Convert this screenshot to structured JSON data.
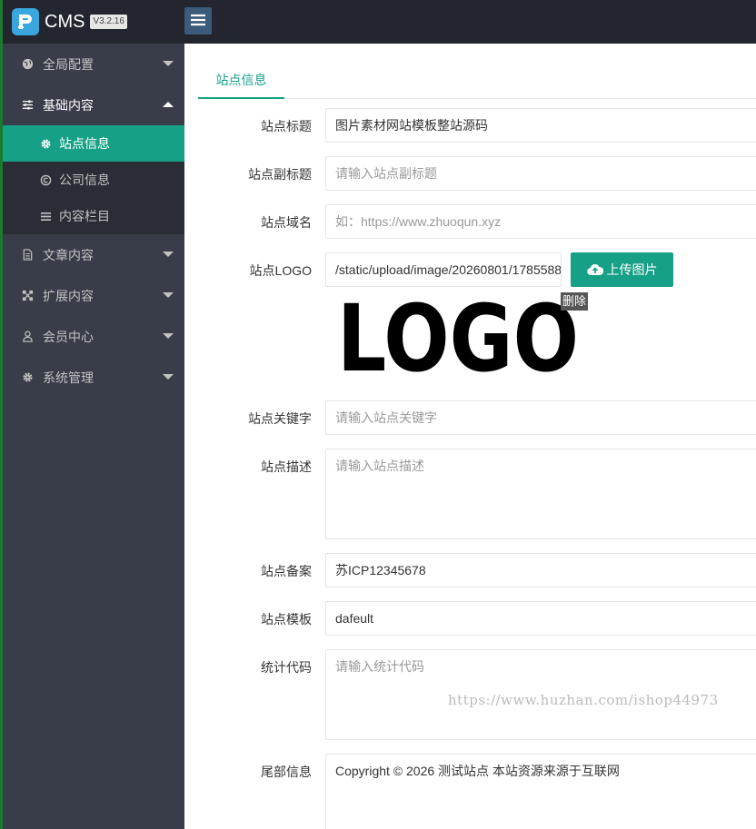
{
  "app": {
    "title": "CMS",
    "version": "V3.2.16"
  },
  "sidebar": {
    "items": [
      {
        "label": "全局配置",
        "icon": "globe-icon"
      },
      {
        "label": "基础内容",
        "icon": "sliders-icon",
        "open": true,
        "children": [
          {
            "label": "站点信息",
            "icon": "gear-icon",
            "active": true
          },
          {
            "label": "公司信息",
            "icon": "copyright-icon"
          },
          {
            "label": "内容栏目",
            "icon": "list-icon"
          }
        ]
      },
      {
        "label": "文章内容",
        "icon": "document-icon"
      },
      {
        "label": "扩展内容",
        "icon": "expand-icon"
      },
      {
        "label": "会员中心",
        "icon": "user-icon"
      },
      {
        "label": "系统管理",
        "icon": "gear-icon"
      }
    ]
  },
  "tabs": [
    {
      "label": "站点信息",
      "active": true
    }
  ],
  "form": {
    "site_title": {
      "label": "站点标题",
      "value": "图片素材网站模板整站源码"
    },
    "site_subtitle": {
      "label": "站点副标题",
      "placeholder": "请输入站点副标题"
    },
    "site_domain": {
      "label": "站点域名",
      "placeholder": "如：https://www.zhuoqun.xyz"
    },
    "site_logo": {
      "label": "站点LOGO",
      "value": "/static/upload/image/20260801/1785588",
      "upload_label": "上传图片",
      "delete_label": "删除",
      "preview_text": "LOGO"
    },
    "site_keywords": {
      "label": "站点关键字",
      "placeholder": "请输入站点关键字"
    },
    "site_description": {
      "label": "站点描述",
      "placeholder": "请输入站点描述"
    },
    "site_icp": {
      "label": "站点备案",
      "value": "苏ICP12345678"
    },
    "site_template": {
      "label": "站点模板",
      "value": "dafeult"
    },
    "stat_code": {
      "label": "统计代码",
      "placeholder": "请输入统计代码"
    },
    "footer_info": {
      "label": "尾部信息",
      "value": "Copyright © 2026 测试站点 本站资源来源于互联网"
    }
  },
  "watermark": "https://www.huzhan.com/ishop44973",
  "colors": {
    "accent": "#16a085",
    "sidebar": "#393d49",
    "topbar": "#23262e"
  }
}
